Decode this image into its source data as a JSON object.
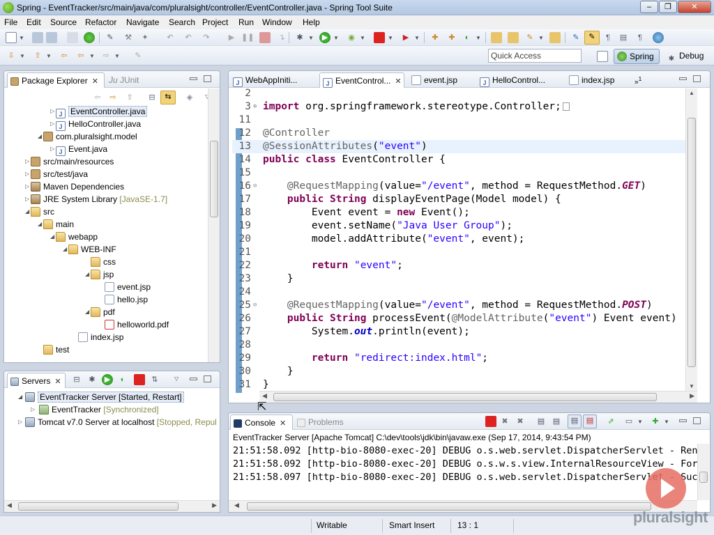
{
  "window": {
    "title": "Spring - EventTracker/src/main/java/com/pluralsight/controller/EventController.java - Spring Tool Suite"
  },
  "menu": [
    "File",
    "Edit",
    "Source",
    "Refactor",
    "Navigate",
    "Search",
    "Project",
    "Run",
    "Window",
    "Help"
  ],
  "toolbar": {
    "quick_access_placeholder": "Quick Access",
    "perspective_spring": "Spring",
    "perspective_debug": "Debug"
  },
  "explorer": {
    "tabs": {
      "package_explorer": "Package Explorer",
      "junit": "JUnit"
    },
    "items": [
      {
        "label": "EventController.java"
      },
      {
        "label": "HelloController.java"
      },
      {
        "label": "com.pluralsight.model"
      },
      {
        "label": "Event.java"
      },
      {
        "label": "src/main/resources"
      },
      {
        "label": "src/test/java"
      },
      {
        "label": "Maven Dependencies"
      },
      {
        "label": "JRE System Library",
        "decoration": "[JavaSE-1.7]"
      },
      {
        "label": "src"
      },
      {
        "label": "main"
      },
      {
        "label": "webapp"
      },
      {
        "label": "WEB-INF"
      },
      {
        "label": "css"
      },
      {
        "label": "jsp"
      },
      {
        "label": "event.jsp"
      },
      {
        "label": "hello.jsp"
      },
      {
        "label": "pdf"
      },
      {
        "label": "helloworld.pdf"
      },
      {
        "label": "index.jsp"
      },
      {
        "label": "test"
      }
    ]
  },
  "servers": {
    "tab": "Servers",
    "items": [
      {
        "label": "EventTracker Server",
        "status": "[Started, Restart]"
      },
      {
        "label": "EventTracker",
        "status": "[Synchronized]"
      },
      {
        "label": "Tomcat v7.0 Server at localhost",
        "status": "[Stopped, Repul"
      }
    ]
  },
  "editor": {
    "tabs": [
      "WebAppIniti...",
      "EventControl...",
      "event.jsp",
      "HelloControl...",
      "index.jsp"
    ],
    "overflow_count": "1",
    "lines": [
      {
        "n": "2",
        "c": ""
      },
      {
        "n": "3",
        "c": "import org.springframework.stereotype.Controller;"
      },
      {
        "n": "11",
        "c": ""
      },
      {
        "n": "12",
        "c": "@Controller"
      },
      {
        "n": "13",
        "c": "@SessionAttributes(\"event\")"
      },
      {
        "n": "14",
        "c": "public class EventController {"
      },
      {
        "n": "15",
        "c": ""
      },
      {
        "n": "16",
        "c": "    @RequestMapping(value=\"/event\", method = RequestMethod.GET)"
      },
      {
        "n": "17",
        "c": "    public String displayEventPage(Model model) {"
      },
      {
        "n": "18",
        "c": "        Event event = new Event();"
      },
      {
        "n": "19",
        "c": "        event.setName(\"Java User Group\");"
      },
      {
        "n": "20",
        "c": "        model.addAttribute(\"event\", event);"
      },
      {
        "n": "21",
        "c": ""
      },
      {
        "n": "22",
        "c": "        return \"event\";"
      },
      {
        "n": "23",
        "c": "    }"
      },
      {
        "n": "24",
        "c": ""
      },
      {
        "n": "25",
        "c": "    @RequestMapping(value=\"/event\", method = RequestMethod.POST)"
      },
      {
        "n": "26",
        "c": "    public String processEvent(@ModelAttribute(\"event\") Event event)"
      },
      {
        "n": "27",
        "c": "        System.out.println(event);"
      },
      {
        "n": "28",
        "c": ""
      },
      {
        "n": "29",
        "c": "        return \"redirect:index.html\";"
      },
      {
        "n": "30",
        "c": "    }"
      },
      {
        "n": "31",
        "c": "}"
      }
    ]
  },
  "console": {
    "tabs": {
      "console": "Console",
      "problems": "Problems"
    },
    "header": "EventTracker Server [Apache Tomcat] C:\\dev\\tools\\jdk\\bin\\javaw.exe (Sep 17, 2014, 9:43:54 PM)",
    "lines": [
      "21:51:58.092 [http-bio-8080-exec-20] DEBUG o.s.web.servlet.DispatcherServlet - Rend",
      "21:51:58.092 [http-bio-8080-exec-20] DEBUG o.s.w.s.view.InternalResourceView - Forw",
      "21:51:58.097 [http-bio-8080-exec-20] DEBUG o.s.web.servlet.DispatcherServlet - Succ"
    ]
  },
  "status": {
    "writable": "Writable",
    "insert_mode": "Smart Insert",
    "position": "13 : 1"
  },
  "watermark": {
    "brand": "pluralsight"
  }
}
